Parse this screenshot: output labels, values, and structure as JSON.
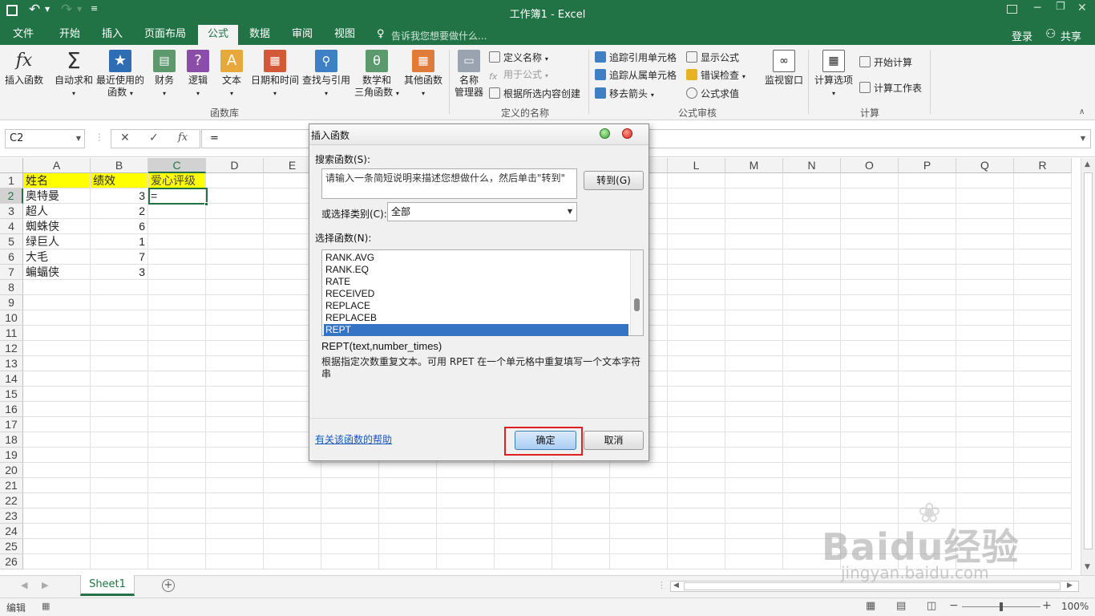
{
  "window": {
    "title": "工作簿1 - Excel"
  },
  "ribbon_tabs": [
    "文件",
    "开始",
    "插入",
    "页面布局",
    "公式",
    "数据",
    "审阅",
    "视图"
  ],
  "tell_me": "告诉我您想要做什么...",
  "account": {
    "login": "登录",
    "share": "共享"
  },
  "ribbon": {
    "insert_function": "插入函数",
    "autosum": "自动求和",
    "recent": [
      "最近使用的",
      "函数"
    ],
    "financial": "财务",
    "logical": "逻辑",
    "text": "文本",
    "datetime": "日期和时间",
    "lookup": "查找与引用",
    "math": [
      "数学和",
      "三角函数"
    ],
    "more": "其他函数",
    "library_group": "函数库",
    "name_manager": [
      "名称",
      "管理器"
    ],
    "define_name": "定义名称",
    "use_in_formula": "用于公式",
    "create_from_selection": "根据所选内容创建",
    "defined_names_group": "定义的名称",
    "trace_precedents": "追踪引用单元格",
    "trace_dependents": "追踪从属单元格",
    "remove_arrows": "移去箭头",
    "show_formulas": "显示公式",
    "error_checking": "错误检查",
    "evaluate_formula": "公式求值",
    "audit_group": "公式审核",
    "watch_window": "监视窗口",
    "calc_options": "计算选项",
    "calc_now": "开始计算",
    "calc_sheet": "计算工作表",
    "calc_group": "计算"
  },
  "formula_bar": {
    "name_box": "C2",
    "content": "="
  },
  "sheet": {
    "columns": [
      "A",
      "B",
      "C",
      "D",
      "E",
      "F",
      "G",
      "H",
      "I",
      "J",
      "K",
      "L",
      "M",
      "N",
      "O",
      "P",
      "Q",
      "R"
    ],
    "rows": [
      "1",
      "2",
      "3",
      "4",
      "5",
      "6",
      "7",
      "8",
      "9",
      "10",
      "11",
      "12",
      "13",
      "14",
      "15",
      "16",
      "17",
      "18",
      "19",
      "20",
      "21",
      "22",
      "23",
      "24",
      "25",
      "26"
    ],
    "header_row": [
      "姓名",
      "绩效",
      "爱心评级"
    ],
    "data": [
      {
        "name": "奥特曼",
        "score": "3",
        "grade": "="
      },
      {
        "name": "超人",
        "score": "2",
        "grade": ""
      },
      {
        "name": "蜘蛛侠",
        "score": "6",
        "grade": ""
      },
      {
        "name": "绿巨人",
        "score": "1",
        "grade": ""
      },
      {
        "name": "大毛",
        "score": "7",
        "grade": ""
      },
      {
        "name": "蝙蝠侠",
        "score": "3",
        "grade": ""
      }
    ],
    "highlight_color": "#ffff00"
  },
  "sheet_tab": "Sheet1",
  "status": {
    "mode": "编辑",
    "zoom": "100%"
  },
  "dialog": {
    "title": "插入函数",
    "search_label": "搜索函数(S):",
    "search_placeholder": "请输入一条简短说明来描述您想做什么，然后单击\"转到\"",
    "goto_button": "转到(G)",
    "category_label": "或选择类别(C):",
    "category_value": "全部",
    "select_label": "选择函数(N):",
    "functions": [
      "RANK.AVG",
      "RANK.EQ",
      "RATE",
      "RECEIVED",
      "REPLACE",
      "REPLACEB",
      "REPT"
    ],
    "selected_index": 6,
    "signature": "REPT(text,number_times)",
    "description": "根据指定次数重复文本。可用 RPET 在一个单元格中重复填写一个文本字符串",
    "help_link": "有关该函数的帮助",
    "ok": "确定",
    "cancel": "取消"
  },
  "watermark": {
    "line1": "Baidu经验",
    "line2": "jingyan.baidu.com"
  },
  "colors": {
    "excel_green": "#217346",
    "selection_blue": "#3574c4",
    "highlight_red": "#e02020"
  }
}
